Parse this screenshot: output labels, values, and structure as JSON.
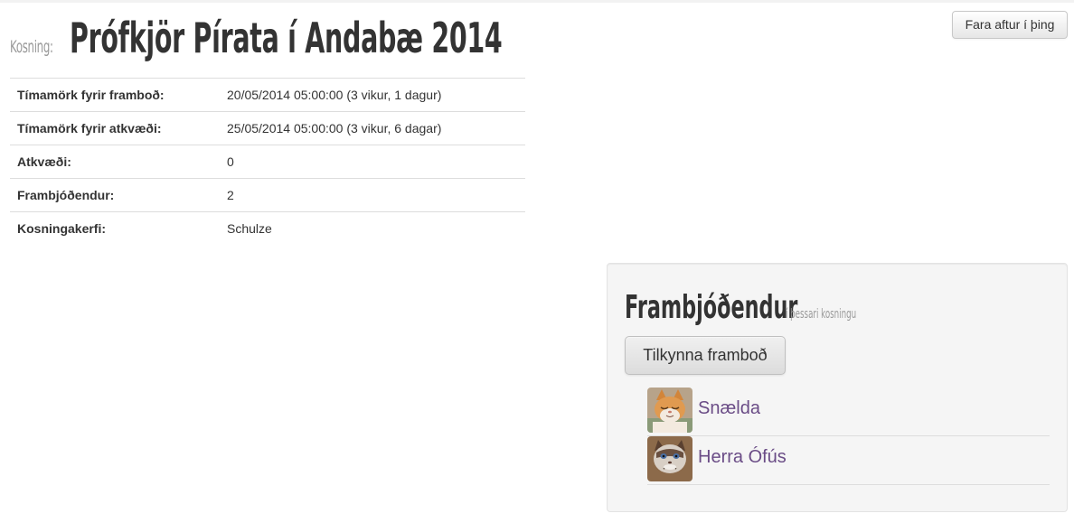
{
  "header": {
    "prefix": "Kosning:",
    "title": "Prófkjör Pírata í Andabæ 2014",
    "back_button": "Fara aftur í þing"
  },
  "info": [
    {
      "label": "Tímamörk fyrir framboð:",
      "value": "20/05/2014 05:00:00 (3 vikur, 1 dagur)"
    },
    {
      "label": "Tímamörk fyrir atkvæði:",
      "value": "25/05/2014 05:00:00 (3 vikur, 6 dagar)"
    },
    {
      "label": "Atkvæði:",
      "value": "0"
    },
    {
      "label": "Frambjóðendur:",
      "value": "2"
    },
    {
      "label": "Kosningakerfi:",
      "value": "Schulze"
    }
  ],
  "candidates_panel": {
    "title": "Frambjóðendur",
    "subtitle": "í þessari kosningu",
    "announce_button": "Tilkynna framboð",
    "candidates": [
      {
        "name": "Snælda",
        "avatar": "orange-cat-avatar"
      },
      {
        "name": "Herra Ófús",
        "avatar": "grumpy-cat-avatar"
      }
    ]
  },
  "colors": {
    "link": "#6a4c86",
    "muted": "#999999",
    "text": "#333333",
    "panel_bg": "#f5f5f5"
  }
}
